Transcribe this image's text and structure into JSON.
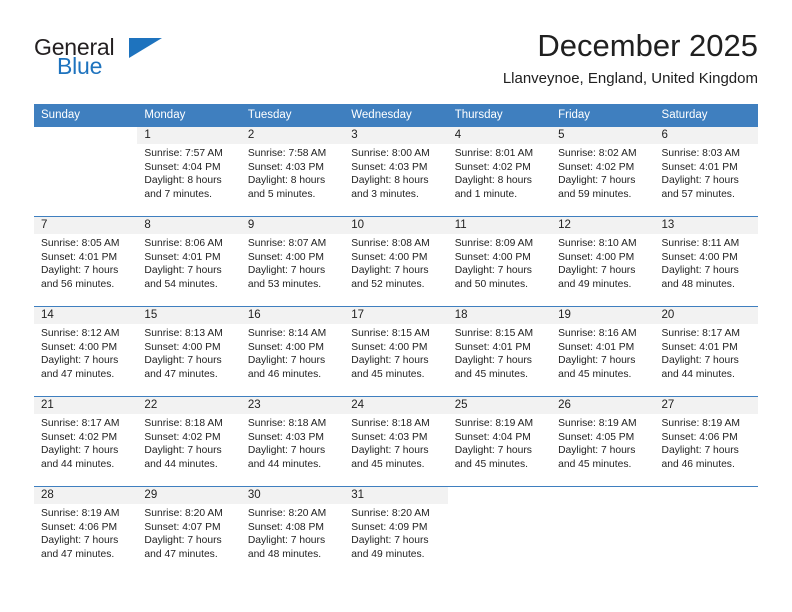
{
  "brand": {
    "name_part1": "General",
    "name_part2": "Blue",
    "triangle_icon": "triangle-icon",
    "accent_color": "#1e73be"
  },
  "header": {
    "title": "December 2025",
    "subtitle": "Llanveynoe, England, United Kingdom"
  },
  "calendar": {
    "header_bg": "#3f7fbf",
    "daynum_bg": "#f2f2f2",
    "weekday_headers": [
      "Sunday",
      "Monday",
      "Tuesday",
      "Wednesday",
      "Thursday",
      "Friday",
      "Saturday"
    ],
    "weeks": [
      [
        {
          "day": "",
          "sunrise": "",
          "sunset": "",
          "daylight1": "",
          "daylight2": ""
        },
        {
          "day": "1",
          "sunrise": "Sunrise: 7:57 AM",
          "sunset": "Sunset: 4:04 PM",
          "daylight1": "Daylight: 8 hours",
          "daylight2": "and 7 minutes."
        },
        {
          "day": "2",
          "sunrise": "Sunrise: 7:58 AM",
          "sunset": "Sunset: 4:03 PM",
          "daylight1": "Daylight: 8 hours",
          "daylight2": "and 5 minutes."
        },
        {
          "day": "3",
          "sunrise": "Sunrise: 8:00 AM",
          "sunset": "Sunset: 4:03 PM",
          "daylight1": "Daylight: 8 hours",
          "daylight2": "and 3 minutes."
        },
        {
          "day": "4",
          "sunrise": "Sunrise: 8:01 AM",
          "sunset": "Sunset: 4:02 PM",
          "daylight1": "Daylight: 8 hours",
          "daylight2": "and 1 minute."
        },
        {
          "day": "5",
          "sunrise": "Sunrise: 8:02 AM",
          "sunset": "Sunset: 4:02 PM",
          "daylight1": "Daylight: 7 hours",
          "daylight2": "and 59 minutes."
        },
        {
          "day": "6",
          "sunrise": "Sunrise: 8:03 AM",
          "sunset": "Sunset: 4:01 PM",
          "daylight1": "Daylight: 7 hours",
          "daylight2": "and 57 minutes."
        }
      ],
      [
        {
          "day": "7",
          "sunrise": "Sunrise: 8:05 AM",
          "sunset": "Sunset: 4:01 PM",
          "daylight1": "Daylight: 7 hours",
          "daylight2": "and 56 minutes."
        },
        {
          "day": "8",
          "sunrise": "Sunrise: 8:06 AM",
          "sunset": "Sunset: 4:01 PM",
          "daylight1": "Daylight: 7 hours",
          "daylight2": "and 54 minutes."
        },
        {
          "day": "9",
          "sunrise": "Sunrise: 8:07 AM",
          "sunset": "Sunset: 4:00 PM",
          "daylight1": "Daylight: 7 hours",
          "daylight2": "and 53 minutes."
        },
        {
          "day": "10",
          "sunrise": "Sunrise: 8:08 AM",
          "sunset": "Sunset: 4:00 PM",
          "daylight1": "Daylight: 7 hours",
          "daylight2": "and 52 minutes."
        },
        {
          "day": "11",
          "sunrise": "Sunrise: 8:09 AM",
          "sunset": "Sunset: 4:00 PM",
          "daylight1": "Daylight: 7 hours",
          "daylight2": "and 50 minutes."
        },
        {
          "day": "12",
          "sunrise": "Sunrise: 8:10 AM",
          "sunset": "Sunset: 4:00 PM",
          "daylight1": "Daylight: 7 hours",
          "daylight2": "and 49 minutes."
        },
        {
          "day": "13",
          "sunrise": "Sunrise: 8:11 AM",
          "sunset": "Sunset: 4:00 PM",
          "daylight1": "Daylight: 7 hours",
          "daylight2": "and 48 minutes."
        }
      ],
      [
        {
          "day": "14",
          "sunrise": "Sunrise: 8:12 AM",
          "sunset": "Sunset: 4:00 PM",
          "daylight1": "Daylight: 7 hours",
          "daylight2": "and 47 minutes."
        },
        {
          "day": "15",
          "sunrise": "Sunrise: 8:13 AM",
          "sunset": "Sunset: 4:00 PM",
          "daylight1": "Daylight: 7 hours",
          "daylight2": "and 47 minutes."
        },
        {
          "day": "16",
          "sunrise": "Sunrise: 8:14 AM",
          "sunset": "Sunset: 4:00 PM",
          "daylight1": "Daylight: 7 hours",
          "daylight2": "and 46 minutes."
        },
        {
          "day": "17",
          "sunrise": "Sunrise: 8:15 AM",
          "sunset": "Sunset: 4:00 PM",
          "daylight1": "Daylight: 7 hours",
          "daylight2": "and 45 minutes."
        },
        {
          "day": "18",
          "sunrise": "Sunrise: 8:15 AM",
          "sunset": "Sunset: 4:01 PM",
          "daylight1": "Daylight: 7 hours",
          "daylight2": "and 45 minutes."
        },
        {
          "day": "19",
          "sunrise": "Sunrise: 8:16 AM",
          "sunset": "Sunset: 4:01 PM",
          "daylight1": "Daylight: 7 hours",
          "daylight2": "and 45 minutes."
        },
        {
          "day": "20",
          "sunrise": "Sunrise: 8:17 AM",
          "sunset": "Sunset: 4:01 PM",
          "daylight1": "Daylight: 7 hours",
          "daylight2": "and 44 minutes."
        }
      ],
      [
        {
          "day": "21",
          "sunrise": "Sunrise: 8:17 AM",
          "sunset": "Sunset: 4:02 PM",
          "daylight1": "Daylight: 7 hours",
          "daylight2": "and 44 minutes."
        },
        {
          "day": "22",
          "sunrise": "Sunrise: 8:18 AM",
          "sunset": "Sunset: 4:02 PM",
          "daylight1": "Daylight: 7 hours",
          "daylight2": "and 44 minutes."
        },
        {
          "day": "23",
          "sunrise": "Sunrise: 8:18 AM",
          "sunset": "Sunset: 4:03 PM",
          "daylight1": "Daylight: 7 hours",
          "daylight2": "and 44 minutes."
        },
        {
          "day": "24",
          "sunrise": "Sunrise: 8:18 AM",
          "sunset": "Sunset: 4:03 PM",
          "daylight1": "Daylight: 7 hours",
          "daylight2": "and 45 minutes."
        },
        {
          "day": "25",
          "sunrise": "Sunrise: 8:19 AM",
          "sunset": "Sunset: 4:04 PM",
          "daylight1": "Daylight: 7 hours",
          "daylight2": "and 45 minutes."
        },
        {
          "day": "26",
          "sunrise": "Sunrise: 8:19 AM",
          "sunset": "Sunset: 4:05 PM",
          "daylight1": "Daylight: 7 hours",
          "daylight2": "and 45 minutes."
        },
        {
          "day": "27",
          "sunrise": "Sunrise: 8:19 AM",
          "sunset": "Sunset: 4:06 PM",
          "daylight1": "Daylight: 7 hours",
          "daylight2": "and 46 minutes."
        }
      ],
      [
        {
          "day": "28",
          "sunrise": "Sunrise: 8:19 AM",
          "sunset": "Sunset: 4:06 PM",
          "daylight1": "Daylight: 7 hours",
          "daylight2": "and 47 minutes."
        },
        {
          "day": "29",
          "sunrise": "Sunrise: 8:20 AM",
          "sunset": "Sunset: 4:07 PM",
          "daylight1": "Daylight: 7 hours",
          "daylight2": "and 47 minutes."
        },
        {
          "day": "30",
          "sunrise": "Sunrise: 8:20 AM",
          "sunset": "Sunset: 4:08 PM",
          "daylight1": "Daylight: 7 hours",
          "daylight2": "and 48 minutes."
        },
        {
          "day": "31",
          "sunrise": "Sunrise: 8:20 AM",
          "sunset": "Sunset: 4:09 PM",
          "daylight1": "Daylight: 7 hours",
          "daylight2": "and 49 minutes."
        },
        {
          "day": "",
          "sunrise": "",
          "sunset": "",
          "daylight1": "",
          "daylight2": ""
        },
        {
          "day": "",
          "sunrise": "",
          "sunset": "",
          "daylight1": "",
          "daylight2": ""
        },
        {
          "day": "",
          "sunrise": "",
          "sunset": "",
          "daylight1": "",
          "daylight2": ""
        }
      ]
    ]
  }
}
